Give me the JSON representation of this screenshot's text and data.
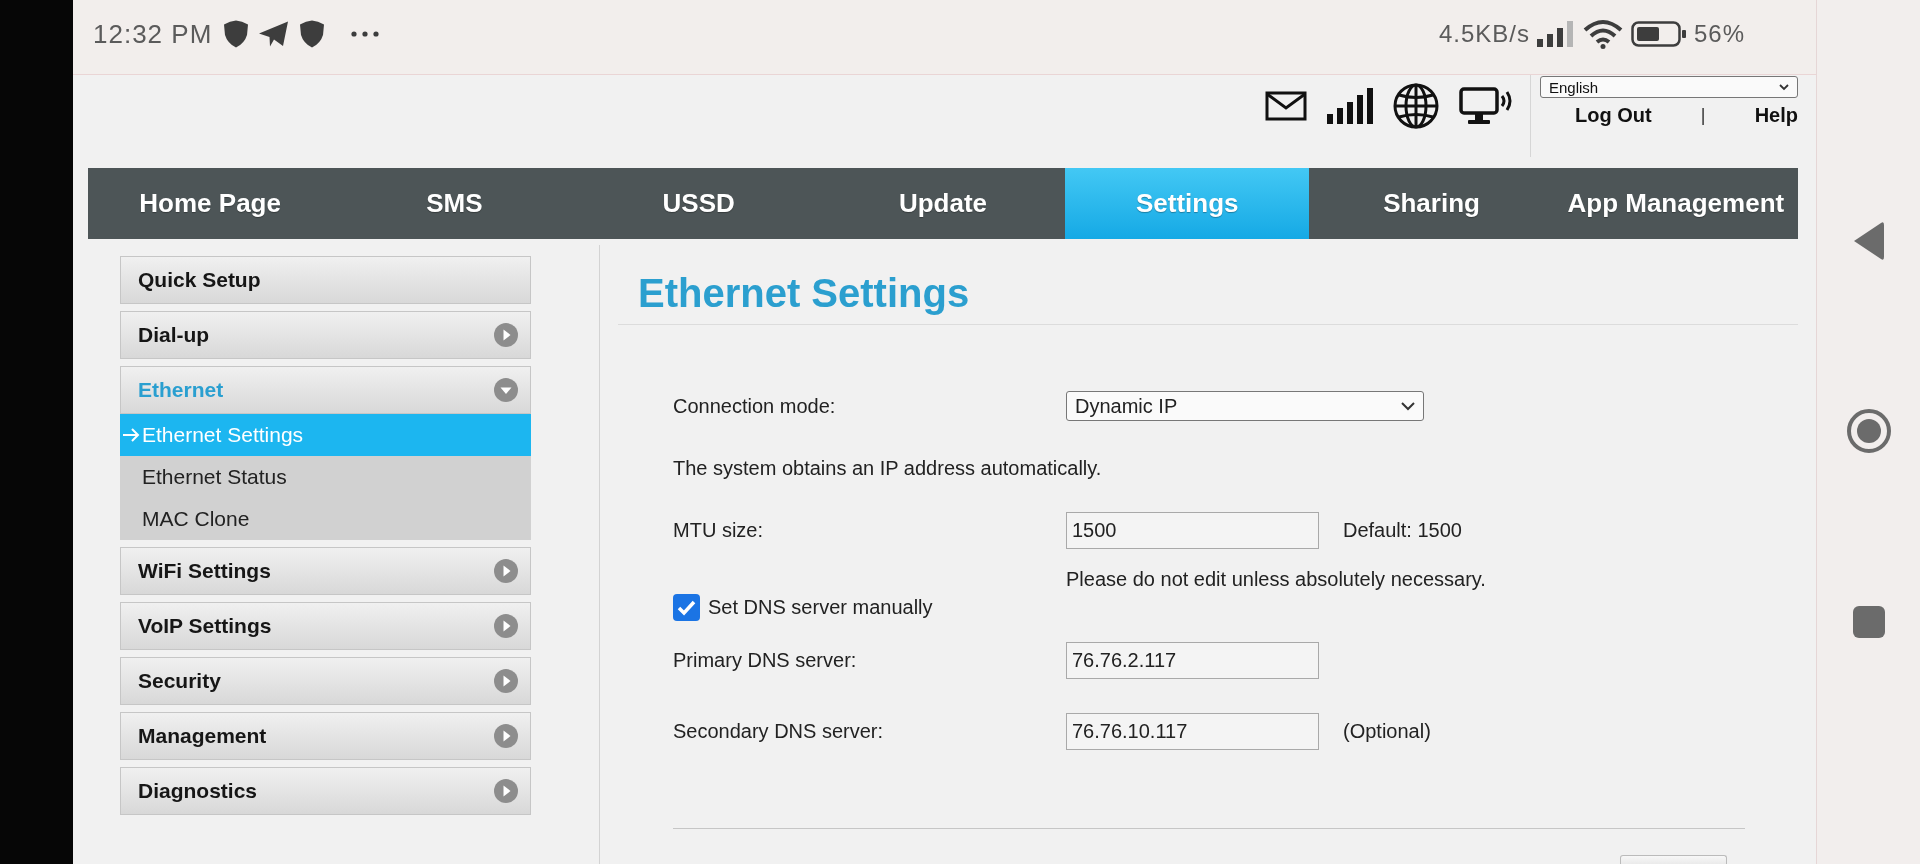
{
  "status_bar": {
    "time": "12:32 PM",
    "network_speed": "4.5KB/s",
    "battery_percent": "56%"
  },
  "header": {
    "language": "English",
    "links": [
      "Log Out",
      "Help"
    ],
    "separator": "|"
  },
  "nav": {
    "tabs": [
      {
        "label": "Home Page",
        "selected": false
      },
      {
        "label": "SMS",
        "selected": false
      },
      {
        "label": "USSD",
        "selected": false
      },
      {
        "label": "Update",
        "selected": false
      },
      {
        "label": "Settings",
        "selected": true
      },
      {
        "label": "Sharing",
        "selected": false
      },
      {
        "label": "App Management",
        "selected": false
      }
    ]
  },
  "sidebar": {
    "items": [
      {
        "label": "Quick Setup",
        "kind": "link",
        "selected": false
      },
      {
        "label": "Dial-up",
        "kind": "group",
        "selected": false,
        "expanded": false
      },
      {
        "label": "Ethernet",
        "kind": "group",
        "selected": true,
        "expanded": true,
        "children": [
          {
            "label": "Ethernet Settings",
            "selected": true
          },
          {
            "label": "Ethernet Status",
            "selected": false
          },
          {
            "label": "MAC Clone",
            "selected": false
          }
        ]
      },
      {
        "label": "WiFi Settings",
        "kind": "group",
        "selected": false,
        "expanded": false
      },
      {
        "label": "VoIP Settings",
        "kind": "group",
        "selected": false,
        "expanded": false
      },
      {
        "label": "Security",
        "kind": "group",
        "selected": false,
        "expanded": false
      },
      {
        "label": "Management",
        "kind": "group",
        "selected": false,
        "expanded": false
      },
      {
        "label": "Diagnostics",
        "kind": "group",
        "selected": false,
        "expanded": false
      }
    ]
  },
  "content": {
    "title": "Ethernet Settings",
    "form": [
      {
        "kind": "select",
        "label": "Connection mode:",
        "value": "Dynamic IP"
      },
      {
        "kind": "note",
        "text": "The system obtains an IP address automatically."
      },
      {
        "kind": "input",
        "label": "MTU size:",
        "value": "1500",
        "hint": "Default: 1500",
        "warning": "Please do not edit unless absolutely necessary."
      },
      {
        "kind": "checkbox",
        "label": "Set DNS server manually",
        "checked": true
      },
      {
        "kind": "input",
        "label": "Primary DNS server:",
        "value": "76.76.2.117"
      },
      {
        "kind": "input",
        "label": "Secondary DNS server:",
        "value": "76.76.10.117",
        "hint": "(Optional)"
      }
    ]
  }
}
